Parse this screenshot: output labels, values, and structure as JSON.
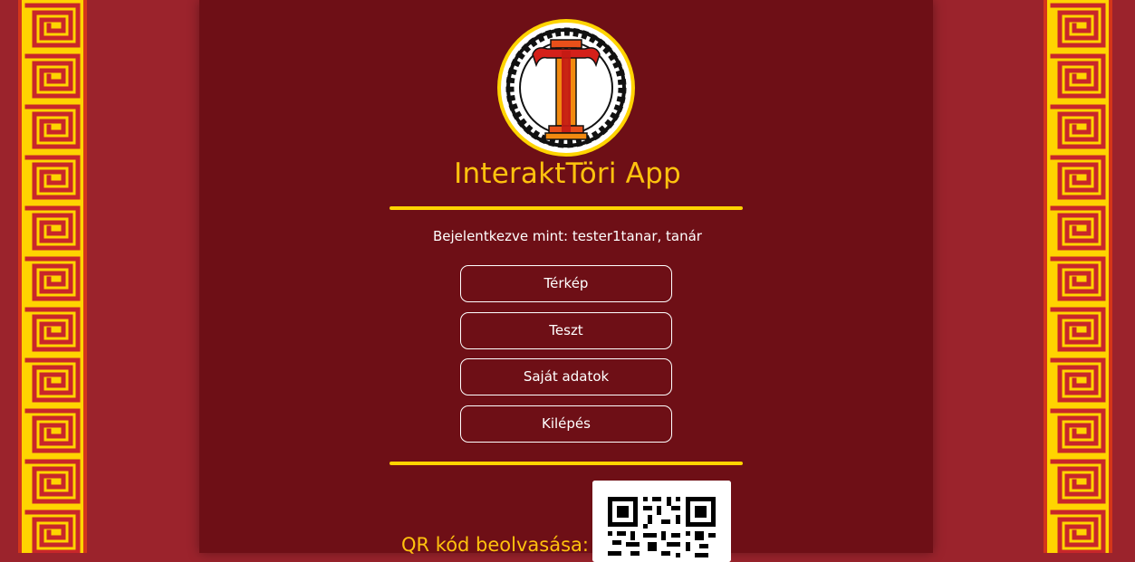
{
  "app": {
    "title": "InteraktTöri App",
    "logged_in_text": "Bejelentkezve mint: tester1tanar, tanár"
  },
  "menu": [
    {
      "label": "Térkép"
    },
    {
      "label": "Teszt"
    },
    {
      "label": "Saját adatok"
    },
    {
      "label": "Kilépés"
    }
  ],
  "qr": {
    "label": "QR kód beolvasása:",
    "icon": "qr-code-icon"
  },
  "logo": {
    "icon": "column-t-logo-icon"
  },
  "colors": {
    "background": "#9b232c",
    "panel": "#6e0f16",
    "accent": "#ffc20e",
    "border_gold": "#ffd400",
    "border_red": "#d4361a"
  }
}
